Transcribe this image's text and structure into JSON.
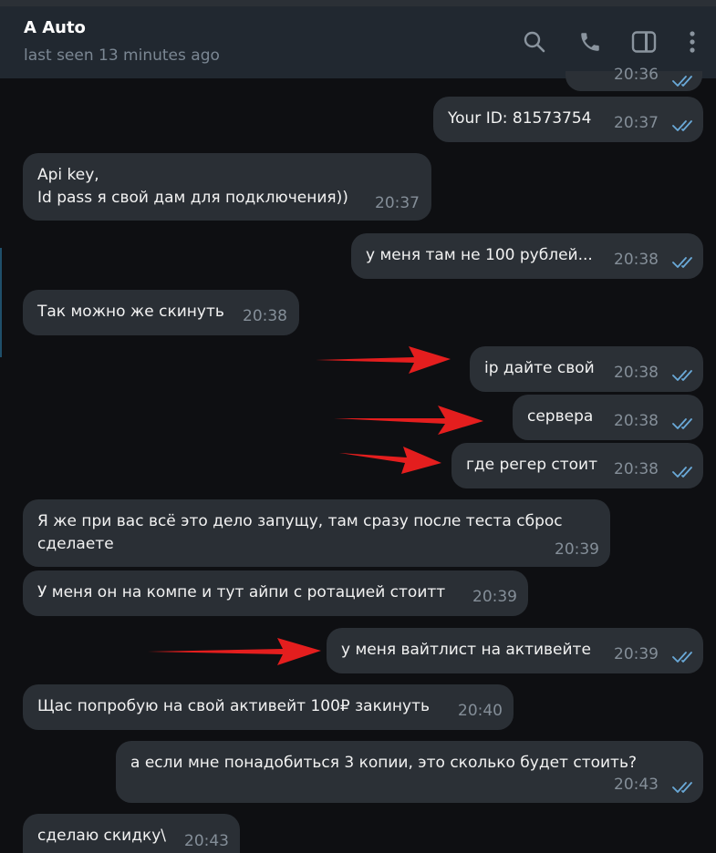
{
  "header": {
    "title": "A Auto",
    "status": "last seen 13 minutes ago",
    "icons": [
      "search-icon",
      "phone-icon",
      "sidebar-toggle-icon",
      "more-vert-icon"
    ]
  },
  "colors": {
    "header_bg": "#212830",
    "incoming_bubble": "#2a2f35",
    "outgoing_bubble": "#2b3036",
    "read_ticks": "#6aa9d8",
    "arrow": "#e41e1e"
  },
  "messages": [
    {
      "dir": "out",
      "text": "",
      "time": "20:36",
      "read": true,
      "partial": true
    },
    {
      "dir": "out",
      "text": "Your ID: 81573754",
      "time": "20:37",
      "read": true
    },
    {
      "dir": "in",
      "text": "Api key,\nId pass я свой дам для подключения))",
      "time": "20:37"
    },
    {
      "dir": "out",
      "text": "у меня там не 100 рублей...",
      "time": "20:38",
      "read": true
    },
    {
      "dir": "in",
      "text": "Так можно же скинуть",
      "time": "20:38"
    },
    {
      "dir": "out",
      "text": "ip дайте свой",
      "time": "20:38",
      "read": true,
      "arrow": true
    },
    {
      "dir": "out",
      "text": "сервера",
      "time": "20:38",
      "read": true,
      "arrow": true
    },
    {
      "dir": "out",
      "text": "где регер стоит",
      "time": "20:38",
      "read": true,
      "arrow": true
    },
    {
      "dir": "in",
      "text": "Я же при вас всё это дело запущу, там сразу после теста сброс\nсделаете",
      "time": "20:39"
    },
    {
      "dir": "in",
      "text": "У меня он на компе и тут айпи с ротацией стоитт",
      "time": "20:39"
    },
    {
      "dir": "out",
      "text": "у меня вайтлист на активейте",
      "time": "20:39",
      "read": true,
      "arrow": true
    },
    {
      "dir": "in",
      "text": "Щас попробую на свой активейт 100₽ закинуть",
      "time": "20:40"
    },
    {
      "dir": "out",
      "text": "а если мне понадобиться 3 копии, это сколько будет стоить?",
      "time": "20:43",
      "read": true
    },
    {
      "dir": "in",
      "text": "сделаю скидку\\",
      "time": "20:43"
    }
  ]
}
